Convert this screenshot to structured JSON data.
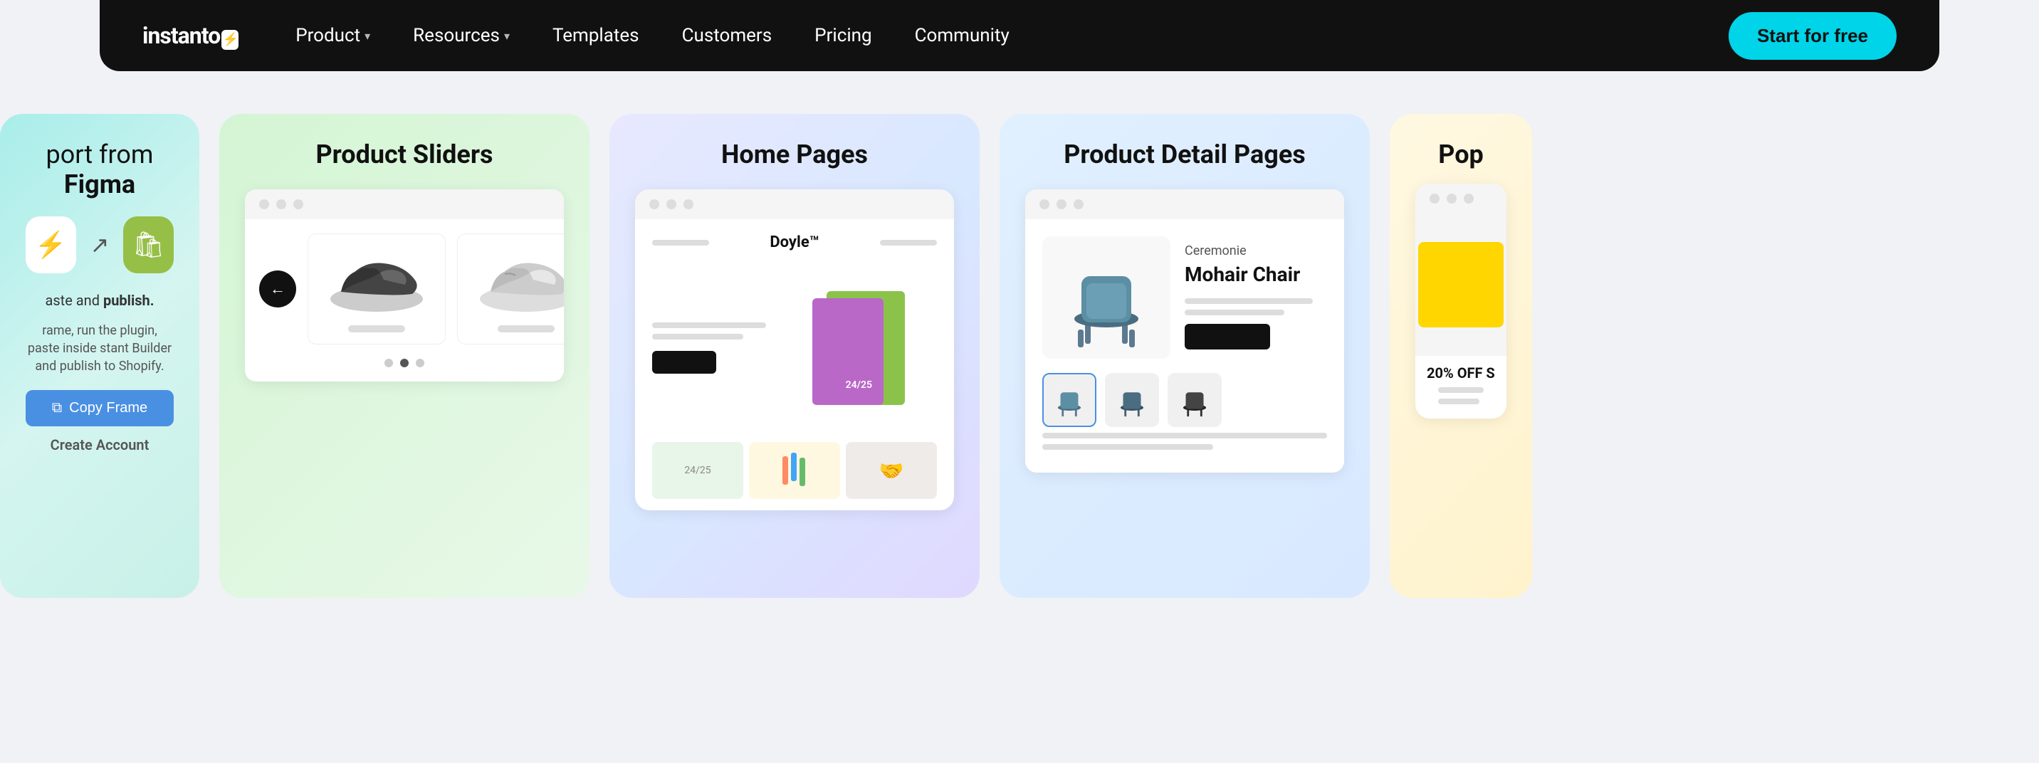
{
  "navbar": {
    "logo_text": "instanto",
    "cta_label": "Start for free",
    "nav_items": [
      {
        "id": "product",
        "label": "Product",
        "has_arrow": true
      },
      {
        "id": "resources",
        "label": "Resources",
        "has_arrow": true
      },
      {
        "id": "templates",
        "label": "Templates",
        "has_arrow": false
      },
      {
        "id": "customers",
        "label": "Customers",
        "has_arrow": false
      },
      {
        "id": "pricing",
        "label": "Pricing",
        "has_arrow": false
      },
      {
        "id": "community",
        "label": "Community",
        "has_arrow": false
      }
    ]
  },
  "cards": {
    "figma": {
      "title_pre": "port from ",
      "title_bold": "Figma",
      "desc_pre": "aste and ",
      "desc_bold": "publish.",
      "subdesc": "rame, run the plugin, paste inside\nstant Builder and publish to Shopify.",
      "copy_frame_label": "Copy Frame",
      "create_account_label": "Create",
      "create_account_bold": "Account"
    },
    "sliders": {
      "title": "Product Sliders"
    },
    "home": {
      "title": "Home Pages",
      "brand": "Doyle™",
      "notebook_label": "24/25"
    },
    "detail": {
      "title": "Product Detail Pages",
      "brand": "Ceremonie",
      "name": "Mohair Chair"
    },
    "partial": {
      "title": "Pop",
      "discount": "20% OFF S"
    }
  },
  "colors": {
    "accent_cyan": "#00d4e8",
    "navbar_bg": "#111111",
    "cta_bg": "#4a90e2"
  }
}
